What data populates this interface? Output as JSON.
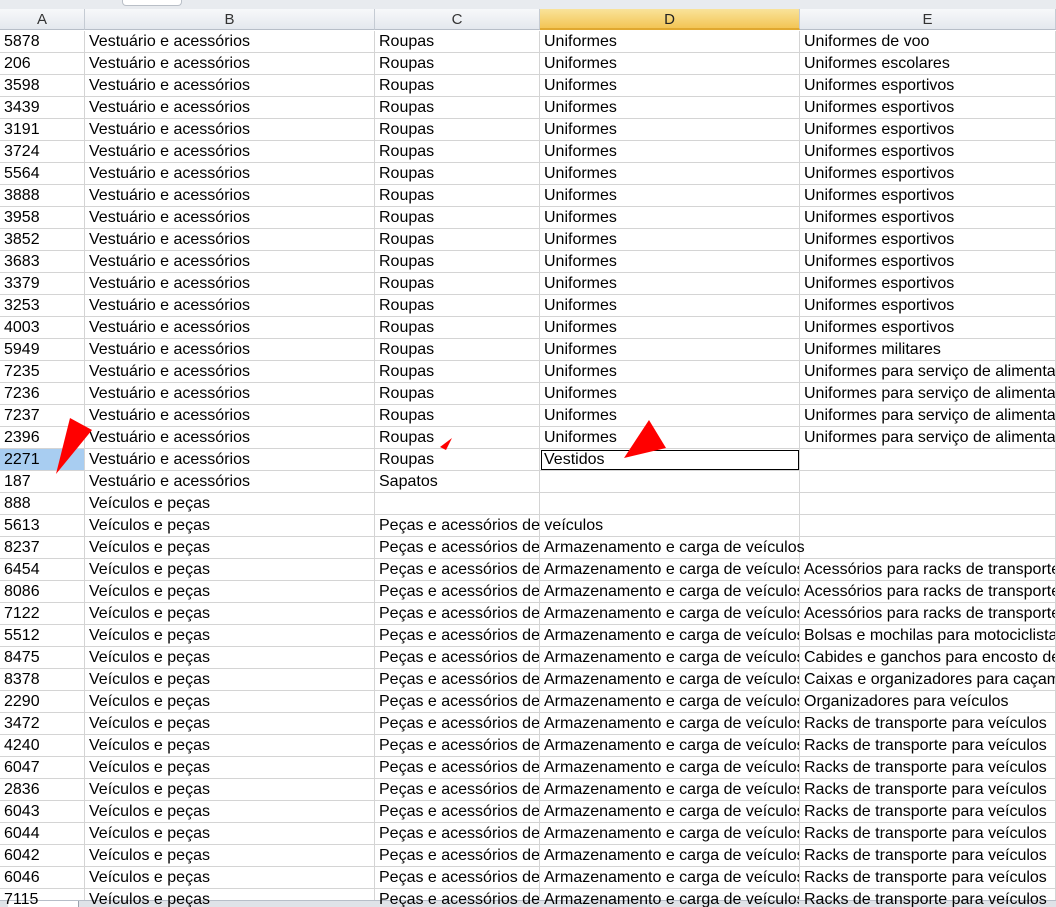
{
  "columns": [
    "A",
    "B",
    "C",
    "D",
    "E"
  ],
  "selected_column": "D",
  "rows": [
    [
      "5878",
      "Vestuário e acessórios",
      "Roupas",
      "Uniformes",
      "Uniformes de voo"
    ],
    [
      "206",
      "Vestuário e acessórios",
      "Roupas",
      "Uniformes",
      "Uniformes escolares"
    ],
    [
      "3598",
      "Vestuário e acessórios",
      "Roupas",
      "Uniformes",
      "Uniformes esportivos"
    ],
    [
      "3439",
      "Vestuário e acessórios",
      "Roupas",
      "Uniformes",
      "Uniformes esportivos"
    ],
    [
      "3191",
      "Vestuário e acessórios",
      "Roupas",
      "Uniformes",
      "Uniformes esportivos"
    ],
    [
      "3724",
      "Vestuário e acessórios",
      "Roupas",
      "Uniformes",
      "Uniformes esportivos"
    ],
    [
      "5564",
      "Vestuário e acessórios",
      "Roupas",
      "Uniformes",
      "Uniformes esportivos"
    ],
    [
      "3888",
      "Vestuário e acessórios",
      "Roupas",
      "Uniformes",
      "Uniformes esportivos"
    ],
    [
      "3958",
      "Vestuário e acessórios",
      "Roupas",
      "Uniformes",
      "Uniformes esportivos"
    ],
    [
      "3852",
      "Vestuário e acessórios",
      "Roupas",
      "Uniformes",
      "Uniformes esportivos"
    ],
    [
      "3683",
      "Vestuário e acessórios",
      "Roupas",
      "Uniformes",
      "Uniformes esportivos"
    ],
    [
      "3379",
      "Vestuário e acessórios",
      "Roupas",
      "Uniformes",
      "Uniformes esportivos"
    ],
    [
      "3253",
      "Vestuário e acessórios",
      "Roupas",
      "Uniformes",
      "Uniformes esportivos"
    ],
    [
      "4003",
      "Vestuário e acessórios",
      "Roupas",
      "Uniformes",
      "Uniformes esportivos"
    ],
    [
      "5949",
      "Vestuário e acessórios",
      "Roupas",
      "Uniformes",
      "Uniformes militares"
    ],
    [
      "7235",
      "Vestuário e acessórios",
      "Roupas",
      "Uniformes",
      "Uniformes para serviço de alimentação"
    ],
    [
      "7236",
      "Vestuário e acessórios",
      "Roupas",
      "Uniformes",
      "Uniformes para serviço de alimentação"
    ],
    [
      "7237",
      "Vestuário e acessórios",
      "Roupas",
      "Uniformes",
      "Uniformes para serviço de alimentação"
    ],
    [
      "2396",
      "Vestuário e acessórios",
      "Roupas",
      "Uniformes",
      "Uniformes para serviço de alimentação"
    ],
    [
      "2271",
      "Vestuário e acessórios",
      "Roupas",
      "Vestidos",
      ""
    ],
    [
      "187",
      "Vestuário e acessórios",
      "Sapatos",
      "",
      ""
    ],
    [
      "888",
      "Veículos e peças",
      "",
      "",
      ""
    ],
    [
      "5613",
      "Veículos e peças",
      "Peças e acessórios de veículos",
      "",
      ""
    ],
    [
      "8237",
      "Veículos e peças",
      "Peças e acessórios de veículos",
      "Armazenamento e carga de veículos",
      ""
    ],
    [
      "6454",
      "Veículos e peças",
      "Peças e acessórios de veículos",
      "Armazenamento e carga de veículos",
      "Acessórios para racks de transporte"
    ],
    [
      "8086",
      "Veículos e peças",
      "Peças e acessórios de veículos",
      "Armazenamento e carga de veículos",
      "Acessórios para racks de transporte"
    ],
    [
      "7122",
      "Veículos e peças",
      "Peças e acessórios de veículos",
      "Armazenamento e carga de veículos",
      "Acessórios para racks de transporte"
    ],
    [
      "5512",
      "Veículos e peças",
      "Peças e acessórios de veículos",
      "Armazenamento e carga de veículos",
      "Bolsas e mochilas para motociclistas"
    ],
    [
      "8475",
      "Veículos e peças",
      "Peças e acessórios de veículos",
      "Armazenamento e carga de veículos",
      "Cabides e ganchos para encosto de"
    ],
    [
      "8378",
      "Veículos e peças",
      "Peças e acessórios de veículos",
      "Armazenamento e carga de veículos",
      "Caixas e organizadores para caçamba"
    ],
    [
      "2290",
      "Veículos e peças",
      "Peças e acessórios de veículos",
      "Armazenamento e carga de veículos",
      "Organizadores para veículos"
    ],
    [
      "3472",
      "Veículos e peças",
      "Peças e acessórios de veículos",
      "Armazenamento e carga de veículos",
      "Racks de transporte para veículos"
    ],
    [
      "4240",
      "Veículos e peças",
      "Peças e acessórios de veículos",
      "Armazenamento e carga de veículos",
      "Racks de transporte para veículos"
    ],
    [
      "6047",
      "Veículos e peças",
      "Peças e acessórios de veículos",
      "Armazenamento e carga de veículos",
      "Racks de transporte para veículos"
    ],
    [
      "2836",
      "Veículos e peças",
      "Peças e acessórios de veículos",
      "Armazenamento e carga de veículos",
      "Racks de transporte para veículos"
    ],
    [
      "6043",
      "Veículos e peças",
      "Peças e acessórios de veículos",
      "Armazenamento e carga de veículos",
      "Racks de transporte para veículos"
    ],
    [
      "6044",
      "Veículos e peças",
      "Peças e acessórios de veículos",
      "Armazenamento e carga de veículos",
      "Racks de transporte para veículos"
    ],
    [
      "6042",
      "Veículos e peças",
      "Peças e acessórios de veículos",
      "Armazenamento e carga de veículos",
      "Racks de transporte para veículos"
    ],
    [
      "6046",
      "Veículos e peças",
      "Peças e acessórios de veículos",
      "Armazenamento e carga de veículos",
      "Racks de transporte para veículos"
    ],
    [
      "7115",
      "Veículos e peças",
      "Peças e acessórios de veículos",
      "Armazenamento e carga de veículos",
      "Racks de transporte para veículos"
    ]
  ],
  "highlighted_cell": "A20",
  "active_cell": "D20",
  "annotation_color": "#ff0000",
  "selected_header_color": "#f5c85a",
  "highlight_color": "#a8cdf1"
}
